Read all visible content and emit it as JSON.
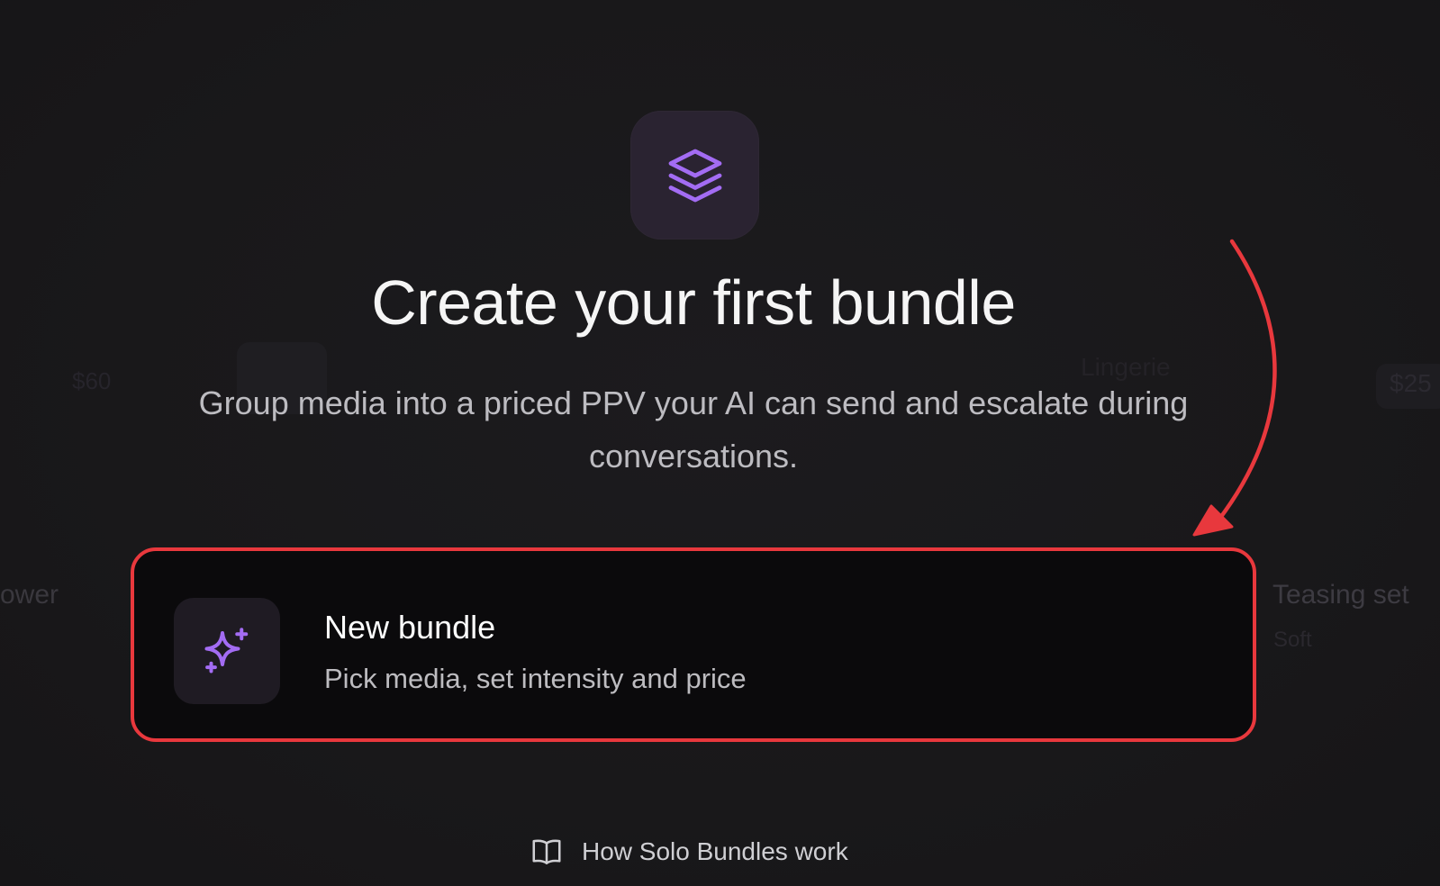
{
  "background_ghosts": {
    "price_left": "$60",
    "price_right": "$25",
    "category": "Lingerie",
    "left_label": "ower",
    "right_label": "Teasing set",
    "right_sublabel": "Soft"
  },
  "hero": {
    "icon": "layers-icon",
    "title": "Create your first bundle",
    "subtitle": "Group media into a priced PPV your AI can send and escalate during conversations."
  },
  "new_bundle_card": {
    "icon": "sparkles-icon",
    "title": "New bundle",
    "description": "Pick media, set intensity and price"
  },
  "help_link": {
    "icon": "book-open-icon",
    "label": "How Solo Bundles work"
  },
  "colors": {
    "accent": "#a06bf0",
    "highlight": "#e8383d",
    "background": "#1a191b"
  }
}
